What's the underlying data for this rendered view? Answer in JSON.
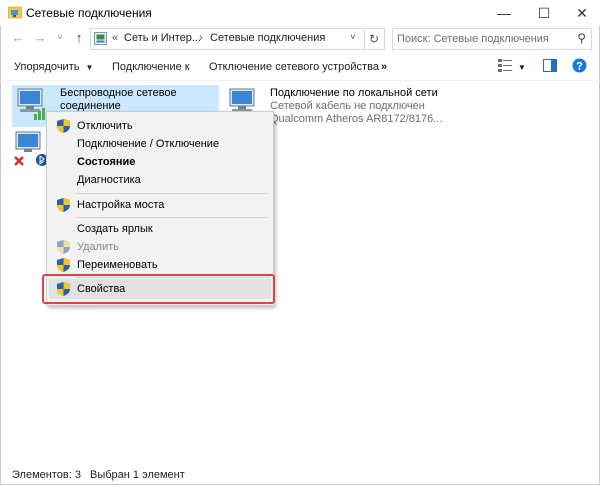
{
  "window": {
    "title": "Сетевые подключения",
    "minimize_icon": "minimize-icon",
    "maximize_icon": "maximize-icon",
    "close_icon": "close-icon"
  },
  "address_bar": {
    "breadcrumbs": [
      "Сеть и Интер...",
      "Сетевые подключения"
    ],
    "search_placeholder": "Поиск: Сетевые подключения"
  },
  "toolbar": {
    "organize": "Упорядочить",
    "connect_to": "Подключение к",
    "disable_device": "Отключение сетевого устройства",
    "more": "»"
  },
  "items": [
    {
      "title_line1": "Беспроводное сетевое",
      "title_line2": "соединение",
      "selected": true
    },
    {
      "title": "Подключение по локальной сети",
      "status": "Сетевой кабель не подключен",
      "device": "Qualcomm Atheros AR8172/8176..."
    }
  ],
  "context_menu": {
    "items": [
      {
        "label": "Отключить",
        "shield": true
      },
      {
        "label": "Подключение / Отключение",
        "shield": false
      },
      {
        "label": "Состояние",
        "shield": false,
        "bold": true
      },
      {
        "label": "Диагностика",
        "shield": false
      },
      {
        "label": "Настройка моста",
        "shield": true
      },
      {
        "label": "Создать ярлык",
        "shield": false
      },
      {
        "label": "Удалить",
        "shield": true,
        "disabled": true
      },
      {
        "label": "Переименовать",
        "shield": true
      },
      {
        "label": "Свойства",
        "shield": true,
        "highlighted": true
      }
    ],
    "highlight_color": "#d9434b"
  },
  "statusbar": {
    "count": "Элементов: 3",
    "selected": "Выбран 1 элемент"
  },
  "colors": {
    "selection": "#cce8ff",
    "help": "#1e78d7"
  }
}
